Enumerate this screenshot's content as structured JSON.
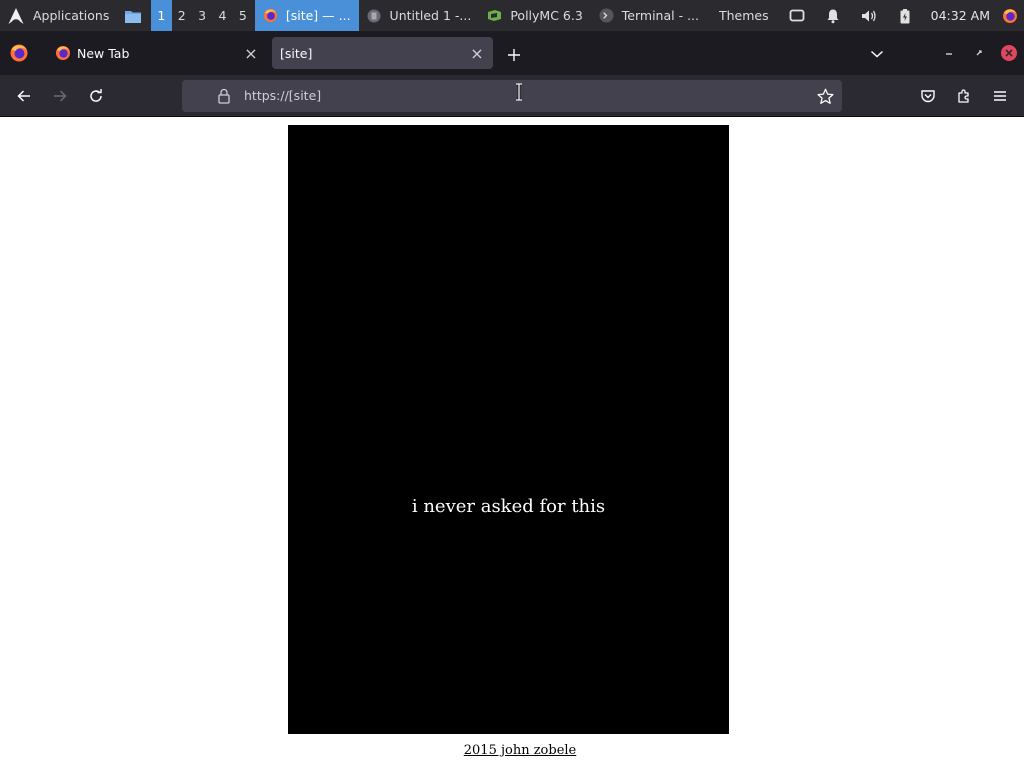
{
  "panel": {
    "applications_label": "Applications",
    "workspaces": [
      "1",
      "2",
      "3",
      "4",
      "5"
    ],
    "active_workspace": "1",
    "tasks": [
      {
        "label": "[site] — ...",
        "icon": "firefox-icon",
        "active": true
      },
      {
        "label": "Untitled 1 -...",
        "icon": "libreoffice-icon",
        "active": false
      },
      {
        "label": "PollyMC 6.3",
        "icon": "pollymc-icon",
        "active": false
      },
      {
        "label": "Terminal - ...",
        "icon": "terminal-icon",
        "active": false
      }
    ],
    "themes_label": "Themes",
    "clock": "04:32 AM",
    "accent_color": "#4a90d9"
  },
  "browser": {
    "tabs": [
      {
        "title": "New Tab",
        "active": false
      },
      {
        "title": "[site]",
        "active": true
      }
    ],
    "url": "https://[site]",
    "url_secure": true
  },
  "page": {
    "poster_text": "i never asked for this",
    "credit_link": "2015 john zobele"
  }
}
